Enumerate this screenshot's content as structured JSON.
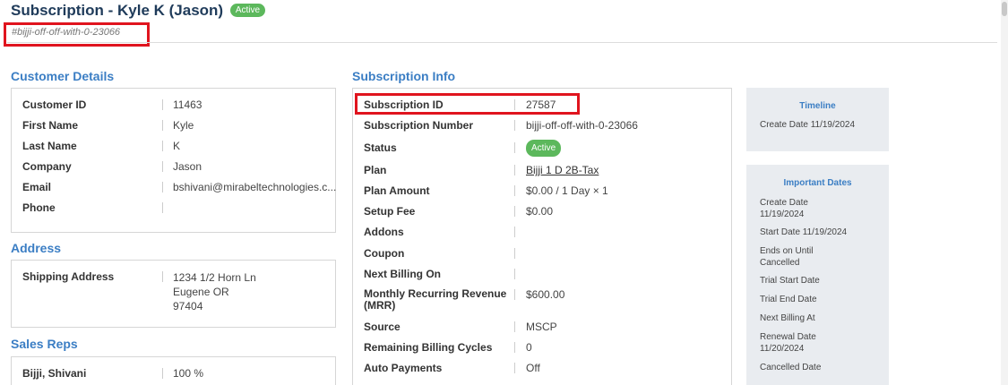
{
  "header": {
    "title": "Subscription - Kyle K (Jason)",
    "status_badge": "Active",
    "slug": "#bijji-off-off-with-0-23066"
  },
  "customer_details": {
    "title": "Customer Details",
    "rows": [
      {
        "label": "Customer ID",
        "value": "11463"
      },
      {
        "label": "First Name",
        "value": "Kyle"
      },
      {
        "label": "Last Name",
        "value": "K"
      },
      {
        "label": "Company",
        "value": "Jason"
      },
      {
        "label": "Email",
        "value": "bshivani@mirabeltechnologies.c..."
      },
      {
        "label": "Phone",
        "value": ""
      }
    ]
  },
  "address": {
    "title": "Address",
    "shipping_label": "Shipping Address",
    "lines": [
      "1234 1/2 Horn Ln",
      "Eugene OR",
      "97404"
    ]
  },
  "sales_reps": {
    "title": "Sales Reps",
    "rows": [
      {
        "label": "Bijji, Shivani",
        "value": "100 %"
      }
    ]
  },
  "subscription_info": {
    "title": "Subscription Info",
    "subscription_id": {
      "label": "Subscription ID",
      "value": "27587"
    },
    "subscription_number": {
      "label": "Subscription Number",
      "value": "bijji-off-off-with-0-23066"
    },
    "status": {
      "label": "Status",
      "value": "Active"
    },
    "plan": {
      "label": "Plan",
      "value": "Bijji 1 D 2B-Tax"
    },
    "plan_amount": {
      "label": "Plan Amount",
      "value": "$0.00 / 1 Day × 1"
    },
    "setup_fee": {
      "label": "Setup Fee",
      "value": "$0.00"
    },
    "addons": {
      "label": "Addons",
      "value": ""
    },
    "coupon": {
      "label": "Coupon",
      "value": ""
    },
    "next_billing": {
      "label": "Next Billing On",
      "value": ""
    },
    "mrr": {
      "label_line1": "Monthly Recurring Revenue",
      "label_line2": "(MRR)",
      "value": "$600.00"
    },
    "source": {
      "label": "Source",
      "value": "MSCP"
    },
    "remaining_cycles": {
      "label": "Remaining Billing Cycles",
      "value": "0"
    },
    "auto_payments": {
      "label": "Auto Payments",
      "value": "Off"
    }
  },
  "timeline": {
    "title": "Timeline",
    "create_date": "Create Date 11/19/2024"
  },
  "important_dates": {
    "title": "Important Dates",
    "items": [
      {
        "line1": "Create Date",
        "line2": "11/19/2024"
      },
      {
        "line1": "Start Date 11/19/2024",
        "line2": ""
      },
      {
        "line1": "Ends on Until",
        "line2": "Cancelled"
      },
      {
        "line1": "Trial Start Date",
        "line2": ""
      },
      {
        "line1": "Trial End Date",
        "line2": ""
      },
      {
        "line1": "Next Billing At",
        "line2": ""
      },
      {
        "line1": "Renewal Date",
        "line2": "11/20/2024"
      },
      {
        "line1": "Cancelled Date",
        "line2": ""
      }
    ]
  },
  "colors": {
    "title": "#1f3b5a",
    "section_title": "#3b7ec4",
    "badge_green": "#5cb85c",
    "highlight_red": "#e0141e",
    "side_panel_bg": "#e9ecf0"
  }
}
